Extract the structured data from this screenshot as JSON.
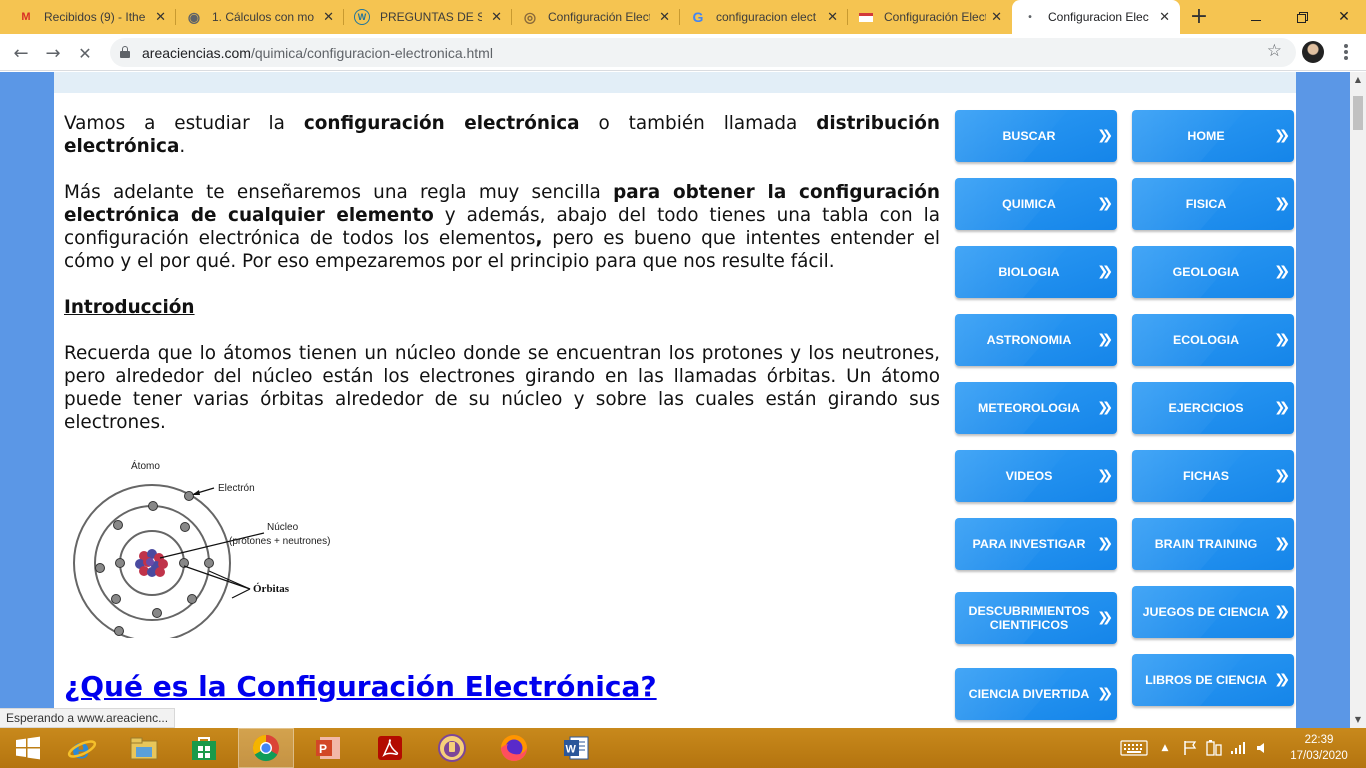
{
  "tabs": [
    {
      "title": "Recibidos (9) - Ithe",
      "icon": "gmail-icon",
      "glyph": "M",
      "color": "#d93025"
    },
    {
      "title": "1. Cálculos con mo",
      "icon": "globe-icon",
      "glyph": "◉",
      "color": "#5f6368"
    },
    {
      "title": "PREGUNTAS DE SE",
      "icon": "wordpress-icon",
      "glyph": "W",
      "color": "#21759b"
    },
    {
      "title": "Configuración Elect",
      "icon": "site-favicon-icon",
      "glyph": "◎",
      "color": "#8a6a3a"
    },
    {
      "title": "configuracion elect",
      "icon": "google-icon",
      "glyph": "G",
      "color": "#4285f4"
    },
    {
      "title": "Configuración Elect",
      "icon": "site-favicon-icon",
      "glyph": "▬",
      "color": "#d23a3a"
    },
    {
      "title": "Configuracion Elec",
      "icon": "loading-icon",
      "glyph": "•",
      "color": "#5f6368"
    }
  ],
  "address": {
    "domain": "areaciencias.com",
    "path": "/quimica/configuracion-electronica.html"
  },
  "article": {
    "p1": {
      "t1": " Vamos a estudiar la ",
      "b1": "configuración electrónica",
      "t2": " o también llamada ",
      "b2": "distribución electrónica",
      "t3": "."
    },
    "p2": {
      "t1": " Más adelante te enseñaremos una regla muy sencilla ",
      "b1": "para obtener la configuración electrónica de cualquier elemento",
      "t2": " y además, abajo del todo tienes una tabla con la configuración electrónica de todos los elementos",
      "b2": ",",
      "t3": " pero es bueno que intentes entender el cómo y el por qué. Por eso empezaremos por el principio para que nos resulte fácil."
    },
    "intro_heading": "Introducción",
    "p3": " Recuerda que lo átomos tienen un núcleo donde se encuentran los protones y los neutrones, pero alrededor del núcleo están los electrones girando en las llamadas órbitas. Un átomo puede tener varias órbitas alrededor de su núcleo y sobre las cuales están girando sus electrones.",
    "section_heading": "¿Qué es la Configuración Electrónica? "
  },
  "diagram": {
    "atom_label": "Átomo",
    "electron_label": "Electrón",
    "nucleus_label": "Núcleo",
    "nucleus_sub": "(protones + neutrones)",
    "orbits_label": "Órbitas"
  },
  "nav_buttons": {
    "left": [
      "BUSCAR",
      "QUIMICA",
      "BIOLOGIA",
      "ASTRONOMIA",
      "METEOROLOGIA",
      "VIDEOS",
      "PARA INVESTIGAR",
      "DESCUBRIMIENTOS CIENTIFICOS",
      "CIENCIA DIVERTIDA"
    ],
    "right": [
      "HOME",
      "FISICA",
      "GEOLOGIA",
      "ECOLOGIA",
      "EJERCICIOS",
      "FICHAS",
      "BRAIN TRAINING",
      "JUEGOS DE CIENCIA",
      "LIBROS DE CIENCIA"
    ]
  },
  "status_text": "Esperando a www.areacienc...",
  "taskbar": {
    "apps": [
      "ie-icon",
      "file-explorer-icon",
      "store-icon",
      "chrome-icon",
      "powerpoint-icon",
      "acrobat-icon",
      "tor-icon",
      "firefox-icon",
      "word-icon"
    ],
    "time": "22:39",
    "date": "17/03/2020"
  }
}
